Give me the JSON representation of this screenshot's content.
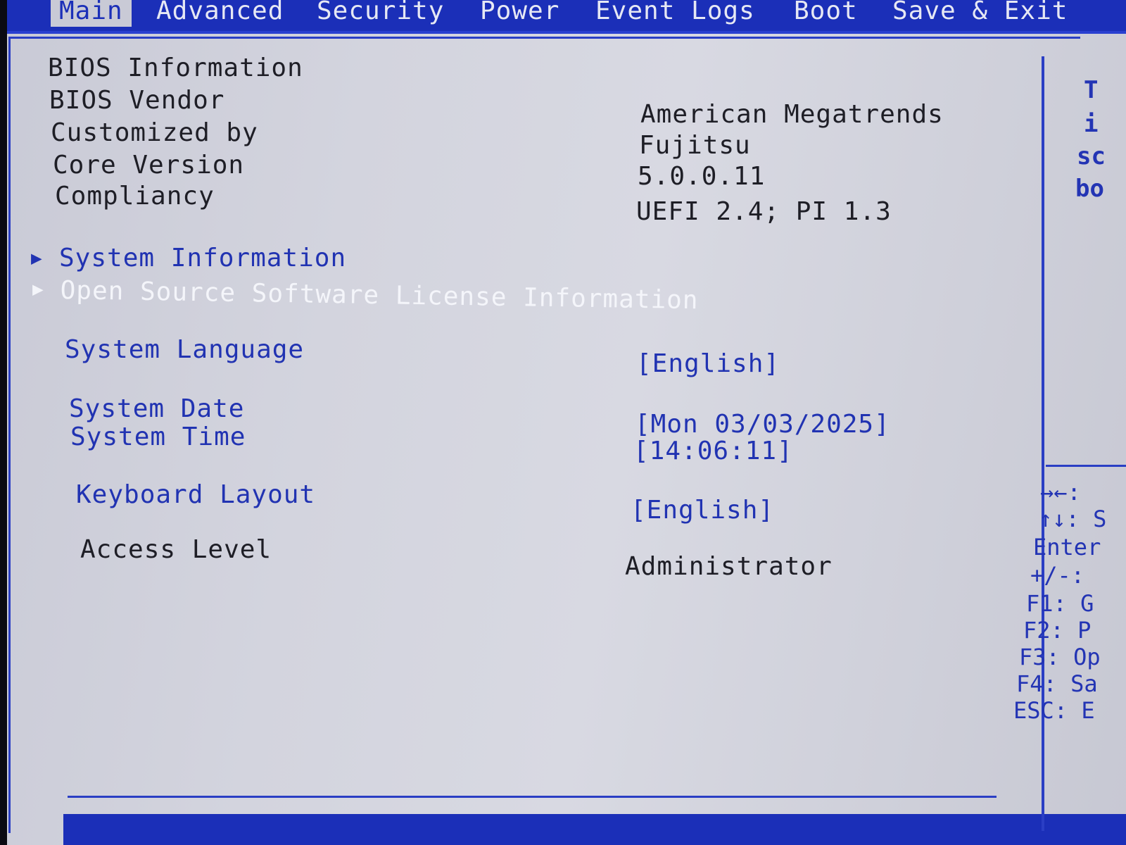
{
  "menu": {
    "items": [
      {
        "label": "Main",
        "active": true
      },
      {
        "label": "Advanced"
      },
      {
        "label": "Security"
      },
      {
        "label": "Power"
      },
      {
        "label": "Event Logs"
      },
      {
        "label": "Boot"
      },
      {
        "label": "Save & Exit"
      }
    ]
  },
  "bios_info": {
    "heading": "BIOS Information",
    "rows": [
      {
        "label": "BIOS Vendor",
        "value": "American Megatrends"
      },
      {
        "label": "Customized by",
        "value": "Fujitsu"
      },
      {
        "label": "Core Version",
        "value": "5.0.0.11"
      },
      {
        "label": "Compliancy",
        "value": "UEFI 2.4; PI 1.3"
      }
    ]
  },
  "submenus": [
    {
      "label": "System Information",
      "arrow": "▶"
    },
    {
      "label": "Open Source Software License Information",
      "arrow": "▶"
    }
  ],
  "settings": {
    "language": {
      "label": "System Language",
      "value": "[English]"
    },
    "date": {
      "label": "System Date",
      "value": "[Mon 03/03/2025]"
    },
    "time": {
      "label": "System Time",
      "value": "[14:06:11]"
    },
    "keyboard": {
      "label": "Keyboard Layout",
      "value": "[English]"
    },
    "access": {
      "label": "Access Level",
      "value": "Administrator"
    }
  },
  "help_panel": {
    "lines": [
      "T",
      "i",
      "sc",
      "bo"
    ]
  },
  "key_legend": [
    "→←: ",
    "↑↓: S",
    "Enter",
    "+/-:",
    "F1: G",
    "F2: P",
    "F3: Op",
    "F4: Sa",
    "ESC: E"
  ],
  "colors": {
    "accent_blue": "#1b2fb8",
    "background": "#d3d4de",
    "text_dark": "#1e1e26",
    "highlight_white": "#f4f5fa"
  }
}
